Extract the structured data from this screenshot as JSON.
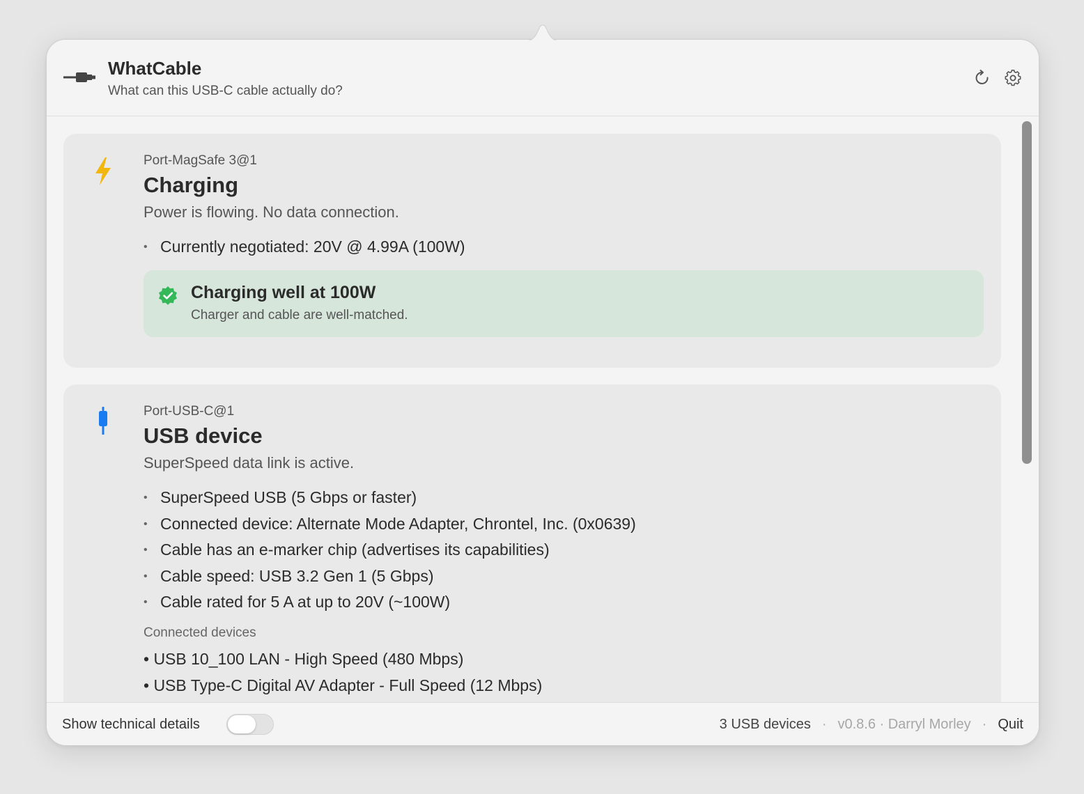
{
  "header": {
    "title": "WhatCable",
    "subtitle": "What can this USB-C cable actually do?"
  },
  "ports": [
    {
      "port_name": "Port-MagSafe 3@1",
      "title": "Charging",
      "description": "Power is flowing. No data connection.",
      "bullets": [
        "Currently negotiated: 20V @ 4.99A (100W)"
      ],
      "status": {
        "title": "Charging well at 100W",
        "subtitle": "Charger and cable are well-matched."
      }
    },
    {
      "port_name": "Port-USB-C@1",
      "title": "USB device",
      "description": "SuperSpeed data link is active.",
      "bullets": [
        "SuperSpeed USB (5 Gbps or faster)",
        "Connected device: Alternate Mode Adapter, Chrontel, Inc. (0x0639)",
        "Cable has an e-marker chip (advertises its capabilities)",
        "Cable speed: USB 3.2 Gen 1 (5 Gbps)",
        "Cable rated for 5 A at up to 20V (~100W)"
      ],
      "devices_heading": "Connected devices",
      "devices": [
        "• USB 10_100 LAN - High Speed (480 Mbps)",
        "• USB Type-C Digital AV Adapter - Full Speed (12 Mbps)"
      ]
    }
  ],
  "footer": {
    "tech_details_label": "Show technical details",
    "tech_details_on": false,
    "device_count": "3 USB devices",
    "separator": "·",
    "version": "v0.8.6 · Darryl Morley",
    "quit_label": "Quit"
  },
  "colors": {
    "bolt": "#f2b70f",
    "usb_plug": "#1a7cf0",
    "success": "#34b85a",
    "status_bg": "#d7e6da"
  },
  "icons": {
    "app": "cable-plug-icon",
    "refresh": "refresh-icon",
    "settings": "gear-icon",
    "charging": "lightning-bolt-icon",
    "usb": "usb-plug-icon",
    "success": "checkmark-seal-icon"
  }
}
